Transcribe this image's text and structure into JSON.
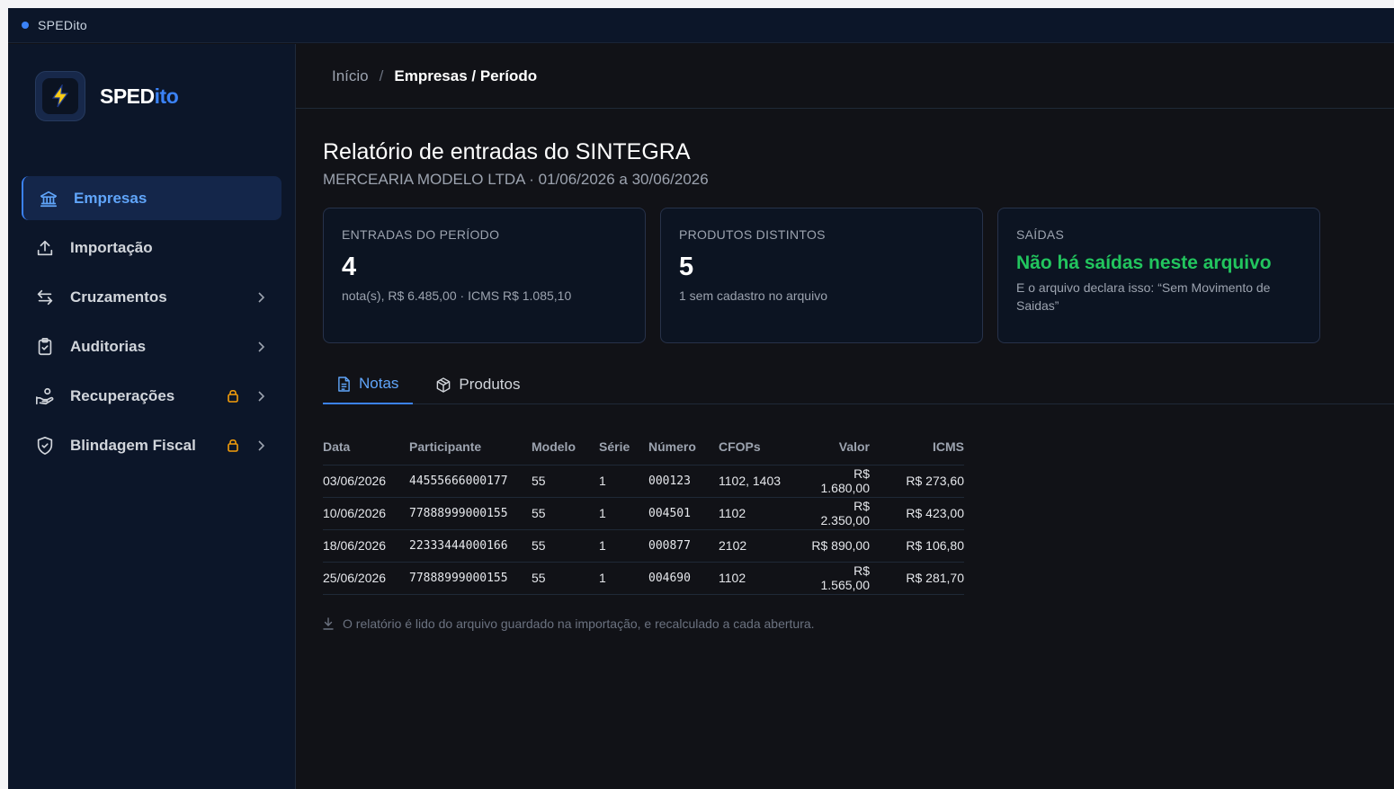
{
  "titlebar": {
    "title": "SPEDito"
  },
  "brand": {
    "part1": "SPED",
    "part2": "ito"
  },
  "sidebar": {
    "items": [
      {
        "label": "Empresas",
        "icon": "bank-icon",
        "active": true
      },
      {
        "label": "Importação",
        "icon": "upload-icon"
      },
      {
        "label": "Cruzamentos",
        "icon": "arrows-swap-icon",
        "chevron": true
      },
      {
        "label": "Auditorias",
        "icon": "clipboard-check-icon",
        "chevron": true
      },
      {
        "label": "Recuperações",
        "icon": "hand-coins-icon",
        "locked": true,
        "chevron": true
      },
      {
        "label": "Blindagem Fiscal",
        "icon": "shield-check-icon",
        "locked": true,
        "chevron": true
      }
    ]
  },
  "breadcrumb": {
    "home": "Início",
    "sep": "/",
    "current": "Empresas / Período"
  },
  "page": {
    "title": "Relatório de entradas do SINTEGRA",
    "subtitle": "MERCEARIA MODELO LTDA · 01/06/2026 a 30/06/2026"
  },
  "cards": {
    "entradas": {
      "label": "ENTRADAS DO PERÍODO",
      "value": "4",
      "detail": "nota(s), R$ 6.485,00 · ICMS R$ 1.085,10"
    },
    "produtos": {
      "label": "PRODUTOS DISTINTOS",
      "value": "5",
      "detail": "1 sem cadastro no arquivo"
    },
    "saidas": {
      "label": "SAÍDAS",
      "value": "Não há saídas neste arquivo",
      "detail": "E o arquivo declara isso: “Sem Movimento de Saidas”",
      "color": "#22c55e"
    }
  },
  "tabs": [
    {
      "label": "Notas",
      "icon": "document-icon",
      "active": true
    },
    {
      "label": "Produtos",
      "icon": "box-icon"
    }
  ],
  "table": {
    "headers": [
      "Data",
      "Participante",
      "Modelo",
      "Série",
      "Número",
      "CFOPs",
      "Valor",
      "ICMS"
    ],
    "rows": [
      [
        "03/06/2026",
        "44555666000177",
        "55",
        "1",
        "000123",
        "1102, 1403",
        "R$ 1.680,00",
        "R$ 273,60"
      ],
      [
        "10/06/2026",
        "77888999000155",
        "55",
        "1",
        "004501",
        "1102",
        "R$ 2.350,00",
        "R$ 423,00"
      ],
      [
        "18/06/2026",
        "22333444000166",
        "55",
        "1",
        "000877",
        "2102",
        "R$ 890,00",
        "R$ 106,80"
      ],
      [
        "25/06/2026",
        "77888999000155",
        "55",
        "1",
        "004690",
        "1102",
        "R$ 1.565,00",
        "R$ 281,70"
      ]
    ]
  },
  "footer": {
    "note": "O relatório é lido do arquivo guardado na importação, e recalculado a cada abertura.",
    "icon": "download-icon"
  },
  "colors": {
    "accent": "#3b82f6",
    "success": "#22c55e",
    "lock": "#f59e0b"
  }
}
